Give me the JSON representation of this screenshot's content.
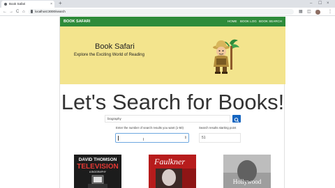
{
  "browser": {
    "tab_title": "Book Safari",
    "new_tab": "+",
    "close_tab": "×",
    "url": "localhost:3000/search",
    "window_controls": [
      "–",
      "☐",
      "×"
    ],
    "nav": [
      "←",
      "→",
      "C",
      "⌂"
    ],
    "star": "☆",
    "menu": "⋮"
  },
  "navbar": {
    "brand": "BOOK SAFARI",
    "links": [
      "HOME",
      "BOOK LOG",
      "BOOK SEARCH"
    ]
  },
  "hero": {
    "title": "Book Safari",
    "subtitle": "Explore the Exciting World of Reading"
  },
  "main": {
    "headline": "Let's Search for Books!",
    "search_value": "biography",
    "num_label": "Enter the number of search results you want (1-50)",
    "start_label": "Search results starting point",
    "start_value": "51"
  },
  "books": [
    {
      "title_line1": "DAVID THOMSON",
      "title_line2": "TELEVISION",
      "subtitle": "A BIOGRAPHY"
    },
    {
      "title_line1": "Faulkner"
    },
    {
      "title_line1": "Hollywood"
    }
  ],
  "colors": {
    "navbar": "#2e8b3a",
    "hero": "#f3e48d",
    "search_button": "#1565c0"
  }
}
